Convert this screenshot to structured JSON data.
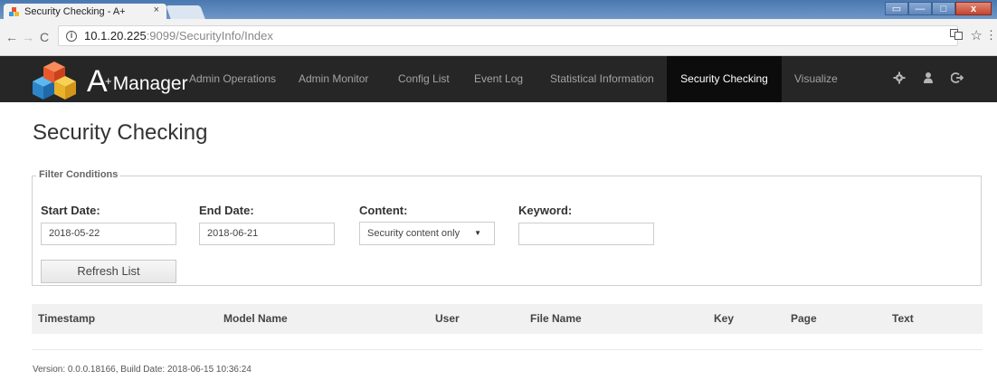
{
  "browser": {
    "tab_title": "Security Checking - A+",
    "tab_close": "×",
    "url_host": "10.1.20.225",
    "url_port_path": ":9099/SecurityInfo/Index",
    "window_buttons": [
      "▭",
      "—",
      "□",
      "x"
    ]
  },
  "app": {
    "brand_letter": "A",
    "brand_plus": "+",
    "brand_name": "Manager",
    "nav_items": [
      "Admin Operations",
      "Admin Monitor",
      "Config List",
      "Event Log",
      "Statistical Information",
      "Security Checking",
      "Visualize"
    ],
    "active_nav": "Security Checking",
    "nav_icons": [
      "gear-icon",
      "user-icon",
      "logout-icon"
    ],
    "colors": {
      "navbar": "#262626",
      "active_nav": "#0c0c0c"
    }
  },
  "page": {
    "title": "Security Checking",
    "filter": {
      "legend": "Filter Conditions",
      "start_date_label": "Start Date:",
      "start_date_value": "2018-05-22",
      "end_date_label": "End Date:",
      "end_date_value": "2018-06-21",
      "content_label": "Content:",
      "content_value": "Security content only",
      "keyword_label": "Keyword:",
      "keyword_value": "",
      "refresh_button": "Refresh List"
    },
    "table": {
      "columns": [
        "Timestamp",
        "Model Name",
        "User",
        "File Name",
        "Key",
        "Page",
        "Text"
      ],
      "rows": []
    },
    "footer": "Version: 0.0.0.18166, Build Date: 2018-06-15 10:36:24"
  }
}
